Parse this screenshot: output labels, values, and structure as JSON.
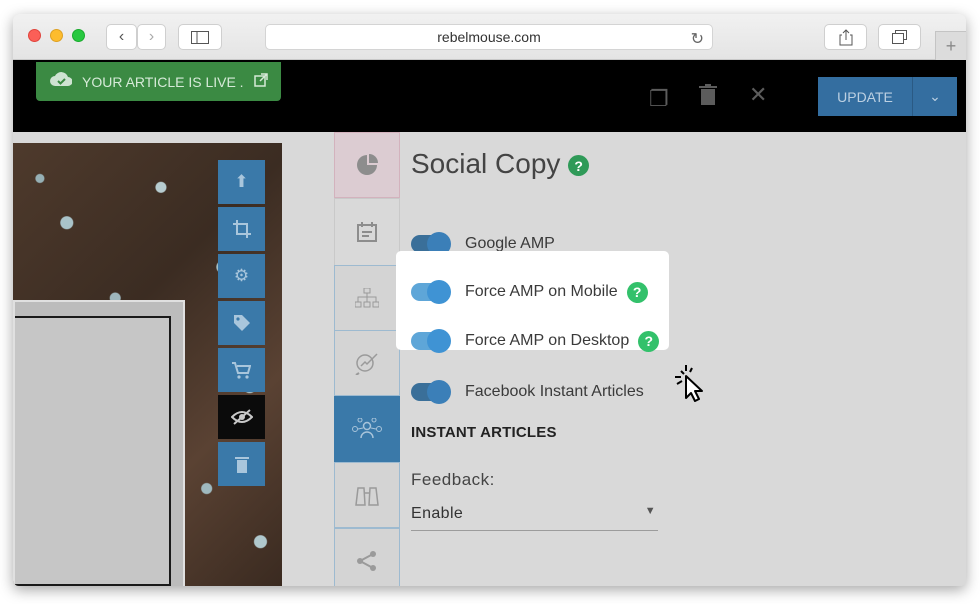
{
  "browser": {
    "url": "rebelmouse.com",
    "back_icon": "chevron-left-icon",
    "forward_icon": "chevron-right-icon",
    "new_tab_glyph": "+"
  },
  "toolbar": {
    "live_status": "YOUR ARTICLE IS LIVE .",
    "update_label": "UPDATE"
  },
  "image_tools": [
    "upload-icon",
    "crop-icon",
    "gear-icon",
    "tag-icon",
    "cart-icon",
    "eye-off-icon",
    "trash-icon"
  ],
  "side_tabs": [
    "pie-chart-icon",
    "calendar-icon",
    "sitemap-icon",
    "search-chart-icon",
    "network-icon",
    "binoculars-icon",
    "share-icon"
  ],
  "panel": {
    "title": "Social Copy",
    "help_glyph": "?",
    "toggles": [
      {
        "label": "Google AMP",
        "on": true
      },
      {
        "label": "Force AMP on Mobile",
        "on": true,
        "help": "?"
      },
      {
        "label": "Force AMP on Desktop",
        "on": true,
        "help": "?"
      },
      {
        "label": "Facebook Instant Articles",
        "on": true
      }
    ],
    "section_heading": "INSTANT ARTICLES",
    "feedback_label": "Feedback:",
    "feedback_value": "Enable"
  },
  "colors": {
    "accent_blue": "#3a79a9",
    "live_green": "#3b8a43",
    "help_green": "#33c16b"
  }
}
